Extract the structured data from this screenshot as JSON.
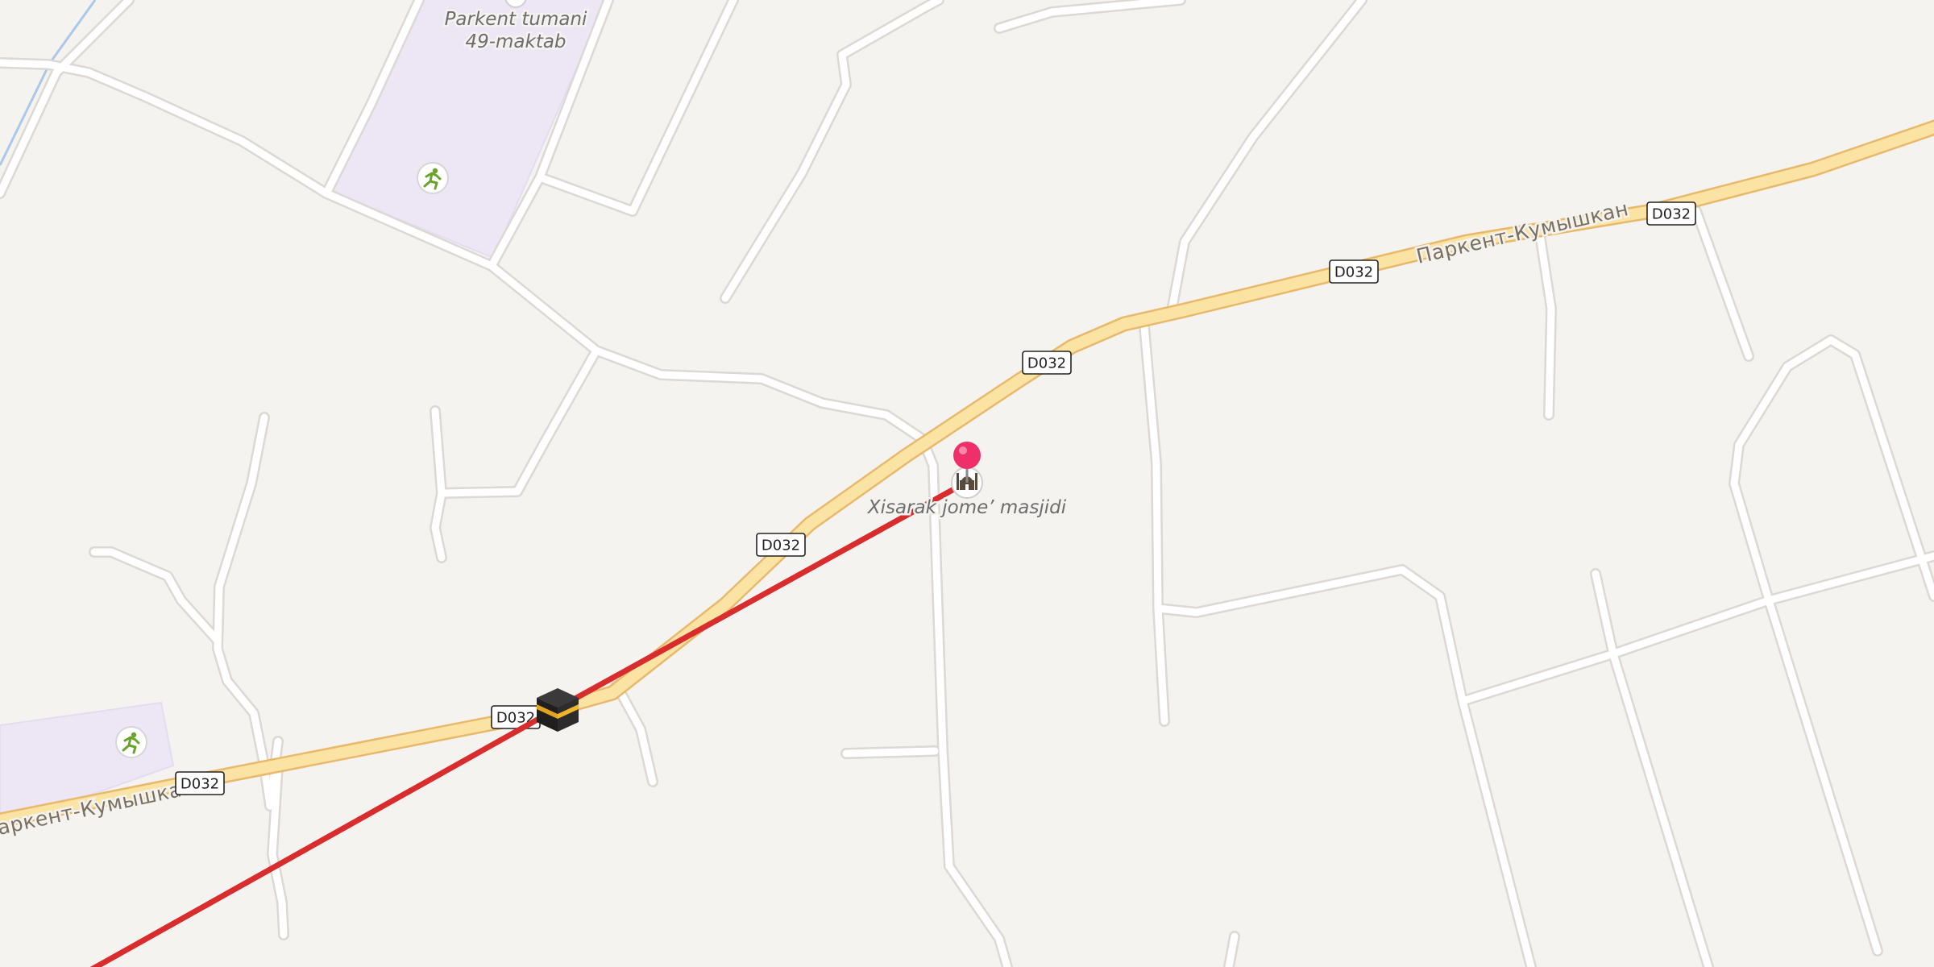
{
  "map": {
    "main_road": {
      "name": "Паркент-Кумышкан",
      "ref": "D032",
      "fill_color": "#fbe3a4",
      "casing_color": "#e9b96b"
    },
    "road_labels": {
      "east": "Паркент-Кумышкан",
      "west": "Паркент-Кумышкан"
    },
    "pois": {
      "school": {
        "name_line1": "Parkent tumani",
        "name_line2": "49-maktab",
        "area_color": "#ede6f5"
      },
      "mosque": {
        "name": "Xisarak jome’ masjidi",
        "icon": "mosque-icon"
      },
      "kaaba": {
        "icon": "kaaba-icon"
      },
      "sports_icon": "running-person-icon"
    },
    "marker": {
      "color": "#ee2f6a",
      "icon": "map-pin-icon"
    },
    "qibla_line": {
      "color": "#d92d2d"
    },
    "water_color": "#a9c8ec",
    "minor_road_color": "#ffffff"
  }
}
